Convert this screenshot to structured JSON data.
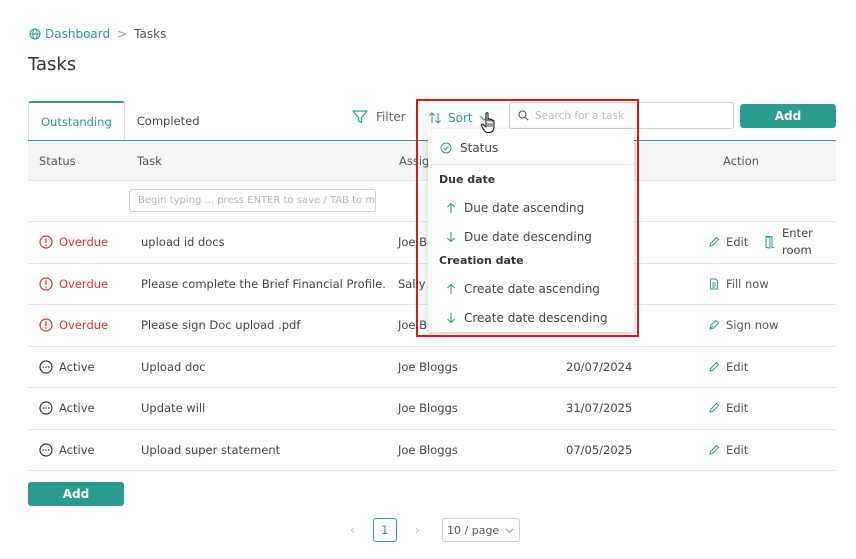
{
  "breadcrumb": {
    "home": "Dashboard",
    "separator": ">",
    "current": "Tasks"
  },
  "page_title": "Tasks",
  "tabs": [
    "Outstanding",
    "Completed"
  ],
  "toolbar": {
    "filter_label": "Filter",
    "sort_label": "Sort",
    "search_placeholder": "Search for a task",
    "add_label": "Add"
  },
  "table": {
    "headers": {
      "status": "Status",
      "task": "Task",
      "assign": "Assig",
      "action": "Action"
    },
    "new_task_placeholder": "Begin typing ... press ENTER to save / TAB to m...",
    "rows": [
      {
        "status": "Overdue",
        "task": "upload id docs",
        "assignee": "Joe Blo",
        "date": "",
        "action": "Edit",
        "extra_action": "Enter room"
      },
      {
        "status": "Overdue",
        "task": "Please complete the Brief Financial Profile.",
        "assignee": "Sally J",
        "date": "",
        "action": "Fill now"
      },
      {
        "status": "Overdue",
        "task": "Please sign Doc upload .pdf",
        "assignee": "Joe Blo",
        "date": "",
        "action": "Sign now"
      },
      {
        "status": "Active",
        "task": "Upload doc",
        "assignee": "Joe Bloggs",
        "date": "20/07/2024",
        "action": "Edit"
      },
      {
        "status": "Active",
        "task": "Update will",
        "assignee": "Joe Bloggs",
        "date": "31/07/2025",
        "action": "Edit"
      },
      {
        "status": "Active",
        "task": "Upload super statement",
        "assignee": "Joe Bloggs",
        "date": "07/05/2025",
        "action": "Edit"
      }
    ]
  },
  "bottom_add_label": "Add",
  "pagination": {
    "current_page": "1",
    "page_size": "10 / page"
  },
  "sort_menu": {
    "status_item": "Status",
    "group_due": "Due date",
    "due_asc": "Due date ascending",
    "due_desc": "Due date descending",
    "group_creation": "Creation date",
    "create_asc": "Create date ascending",
    "create_desc": "Create date descending"
  },
  "colors": {
    "accent": "#2a9d8f",
    "overdue": "#d3333c",
    "highlight": "#e0141b"
  }
}
